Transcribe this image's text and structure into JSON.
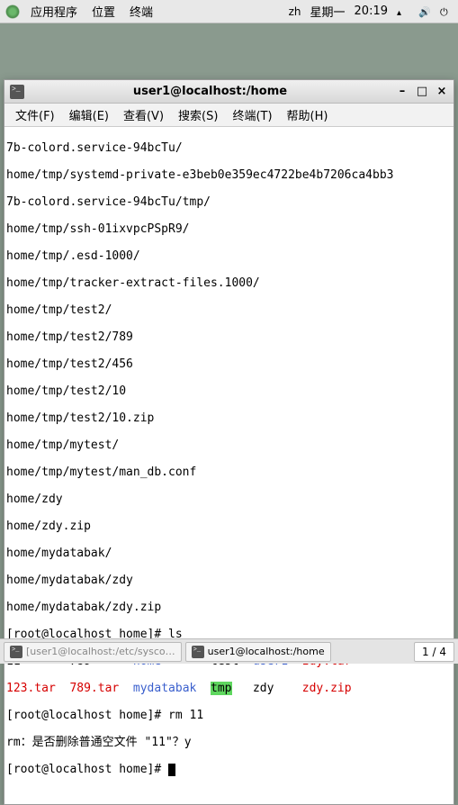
{
  "top_panel": {
    "menu": [
      "应用程序",
      "位置",
      "终端"
    ],
    "lang": "zh",
    "day": "星期一",
    "time": "20:19"
  },
  "window": {
    "title": "user1@localhost:/home",
    "menubar": [
      "文件(F)",
      "编辑(E)",
      "查看(V)",
      "搜索(S)",
      "终端(T)",
      "帮助(H)"
    ]
  },
  "terminal": {
    "lines": [
      "7b-colord.service-94bcTu/",
      "home/tmp/systemd-private-e3beb0e359ec4722be4b7206ca4bb3",
      "7b-colord.service-94bcTu/tmp/",
      "home/tmp/ssh-01ixvpcPSpR9/",
      "home/tmp/.esd-1000/",
      "home/tmp/tracker-extract-files.1000/",
      "home/tmp/test2/",
      "home/tmp/test2/789",
      "home/tmp/test2/456",
      "home/tmp/test2/10",
      "home/tmp/test2/10.zip",
      "home/tmp/mytest/",
      "home/tmp/mytest/man_db.conf",
      "home/zdy",
      "home/zdy.zip",
      "home/mydatabak/",
      "home/mydatabak/zdy",
      "home/mydatabak/zdy.zip"
    ],
    "prompt_ls": "[root@localhost home]# ls",
    "ls_row1": {
      "c0": "11",
      "c1": "789",
      "c2": "home",
      "c3": "test",
      "c4": "user1",
      "c5": "zdy.tar"
    },
    "ls_row2": {
      "c0": "123.tar",
      "c1": "789.tar",
      "c2": "mydatabak",
      "c3": "tmp",
      "c4": "zdy",
      "c5": "zdy.zip"
    },
    "prompt_rm": "[root@localhost home]# rm 11",
    "rm_confirm": "rm：是否删除普通空文件 \"11\"？y",
    "prompt_last": "[root@localhost home]# "
  },
  "taskbar": {
    "items": [
      {
        "label": "[user1@localhost:/etc/sysco…",
        "active": false
      },
      {
        "label": "user1@localhost:/home",
        "active": true
      }
    ],
    "workspace": "1 / 4"
  }
}
